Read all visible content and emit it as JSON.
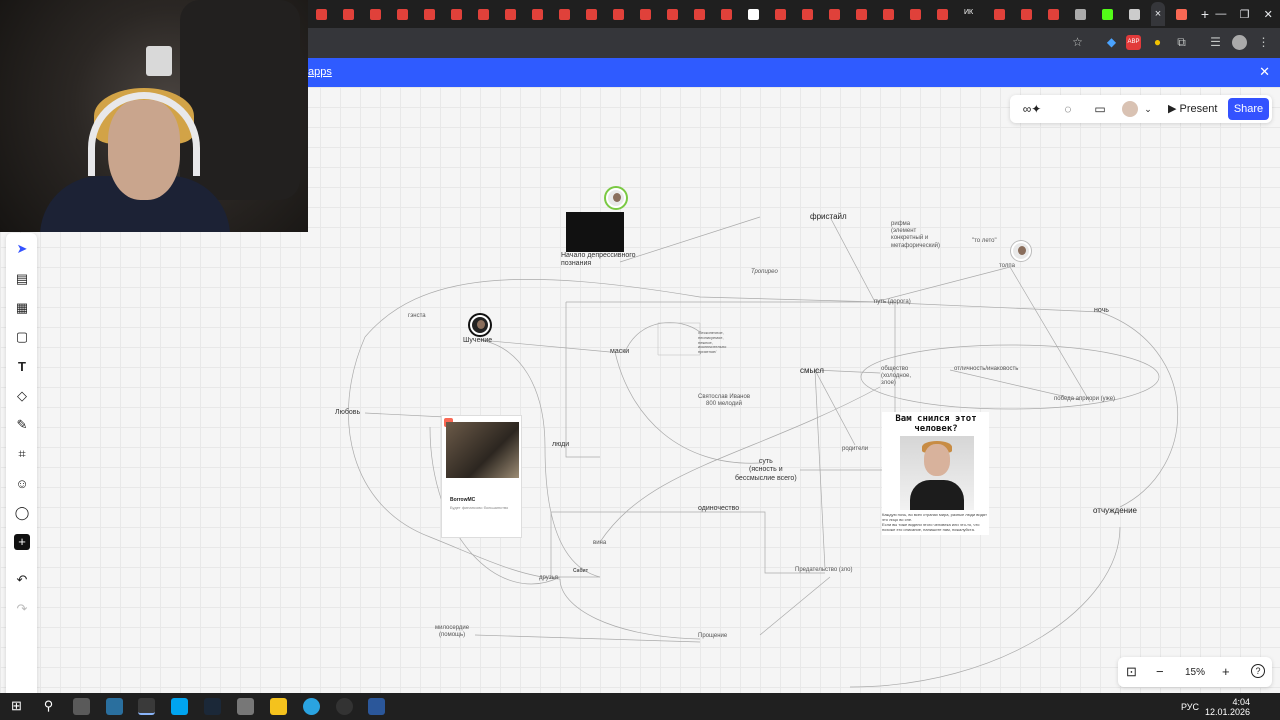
{
  "browser": {
    "tab_icons": [
      "youtube",
      "youtube",
      "youtube",
      "youtube",
      "youtube",
      "youtube",
      "youtube",
      "youtube",
      "youtube",
      "youtube",
      "youtube",
      "youtube",
      "youtube",
      "youtube",
      "youtube",
      "youtube",
      "google",
      "youtube",
      "youtube",
      "youtube",
      "youtube",
      "youtube",
      "youtube",
      "youtube",
      "vk",
      "youtube",
      "youtube",
      "youtube",
      "chrome",
      "kick",
      "speaker"
    ],
    "active_tab_close": "×",
    "new_tab": "+",
    "vk_label": "ИК",
    "window_controls": {
      "minimize": "—",
      "maximize": "❐",
      "close": "✕"
    },
    "toolbar_icons": [
      "star-icon",
      "extension-icon",
      "abp-icon",
      "extension-icon",
      "puzzle-icon",
      "playlist-icon",
      "profile-icon",
      "menu-icon"
    ],
    "abp_label": "ABP"
  },
  "banner": {
    "link_text": "apps",
    "close": "✕"
  },
  "board": {
    "left_tools": [
      "select-tool",
      "sticky-template",
      "frame-tool",
      "sticky-note",
      "text-tool",
      "shapes-tool",
      "pen-tool",
      "crop-tool",
      "emoji-tool",
      "comment-tool",
      "add-tool",
      "undo",
      "redo"
    ],
    "collab": {
      "present_label": "Present",
      "share_label": "Share"
    },
    "zoom": {
      "level": "15%",
      "minus": "−",
      "plus": "+",
      "help": "?"
    },
    "nodes": {
      "start": "Начало депрессивного\nпознания",
      "freestyle": "фристайл",
      "rhyme": "рифма\n(элемент\nконкретный и\nметафорический)",
      "to_leto": "\"то лето\"",
      "crowd": "толпа",
      "tropireo": "Тропирео",
      "path": "путь (дорога)",
      "night": "ночь",
      "gangsta": "гэнста",
      "joking": "Шучение",
      "masks": "маски",
      "small_note": "/бесконечное,\nнеописуемое,\nнежное,\nисключительно\nприятное/",
      "sense": "смысл",
      "society": "общество\n(холодное,\nзлое)",
      "difference": "отличность/инаковость",
      "victory": "победа априори (уже)",
      "love": "Любовь",
      "svyatoslav": "Святослав Иванов\n800 мелодий",
      "people": "люди",
      "parents": "родители",
      "essence": "суть\n(ясность и\nбессмыслие всего)",
      "loneliness": "одиночество",
      "guilt": "вина",
      "alienation": "отчуждение",
      "friends": "друзья",
      "sabit": "Сабит",
      "betrayal": "Предательство (зло)",
      "mercy": "милосердие\n(помощь)",
      "forgiveness": "Прощение"
    },
    "card": {
      "title": "BorrowMC",
      "subtitle": "Будет финансово большинство"
    },
    "poster": {
      "title": "Вам снился этот\nчеловек?",
      "text": "Каждую ночь, во всех странах мира, разные люди видят это лицо во сне.\nЕсли вы тоже видели этого человека или что-то, что похоже его описание, напишите нам, пожалуйста."
    }
  },
  "taskbar": {
    "apps": [
      "windows-start",
      "search",
      "explorer-files",
      "calculator",
      "chrome",
      "app-blue",
      "steam",
      "network-app",
      "file-explorer",
      "telegram",
      "obs",
      "word"
    ],
    "lang": "РУС",
    "time": "4:04",
    "date": "12.01.2026"
  }
}
